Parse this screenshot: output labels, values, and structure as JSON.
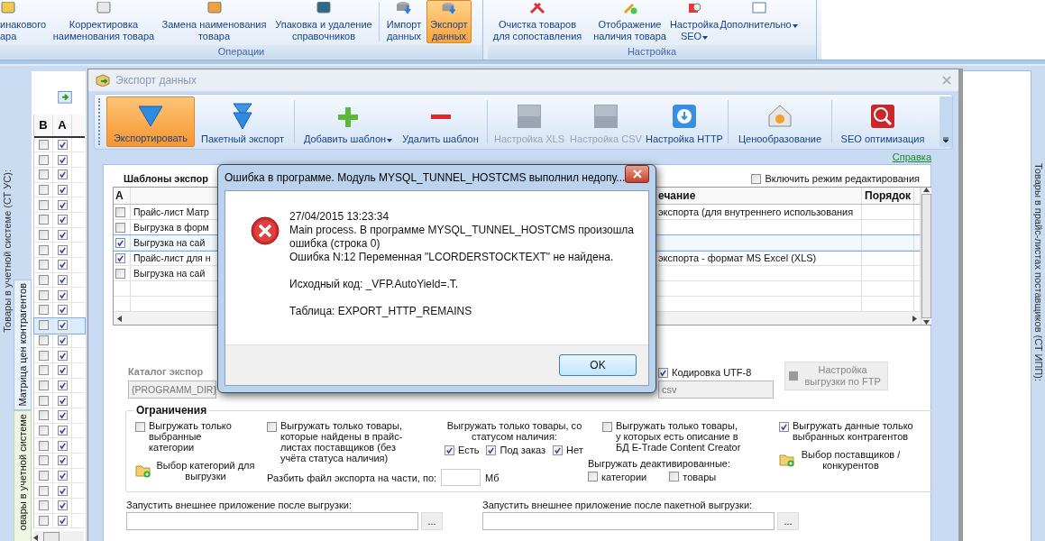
{
  "ribbon": {
    "groups": [
      {
        "label": "Операции",
        "items": [
          {
            "label": "инакового\nара",
            "selected": false,
            "dropdown": false
          },
          {
            "label": "Корректировка\nнаименования товара",
            "selected": false,
            "dropdown": false
          },
          {
            "label": "Замена наименования\nтовара",
            "selected": false,
            "dropdown": false
          },
          {
            "label": "Упаковка и удаление\nсправочников",
            "selected": false,
            "dropdown": false
          },
          {
            "label": "Импорт\nданных",
            "selected": false,
            "dropdown": false
          },
          {
            "label": "Экспорт\nданных",
            "selected": true,
            "dropdown": false
          }
        ]
      },
      {
        "label": "Настройка",
        "items": [
          {
            "label": "Очистка товаров\nдля сопоставления",
            "selected": false,
            "dropdown": false
          },
          {
            "label": "Отображение\nналичия товара",
            "selected": false,
            "dropdown": false
          },
          {
            "label": "Настройка\nSEO",
            "selected": false,
            "dropdown": true
          },
          {
            "label": "Дополнительно",
            "selected": false,
            "dropdown": true
          }
        ]
      }
    ]
  },
  "left_panel": {
    "caption": "Товары в учетной системе (СТ УС):",
    "tabs": [
      {
        "label": "Матрица цен контрагентов",
        "selected": true
      },
      {
        "label": "овары в учетной системе",
        "selected": false
      }
    ],
    "grid": {
      "columns": [
        "В",
        "А"
      ],
      "rows": [
        {
          "c1": false,
          "c2": true,
          "selected": false
        },
        {
          "c1": false,
          "c2": true,
          "selected": false
        },
        {
          "c1": false,
          "c2": true,
          "selected": false
        },
        {
          "c1": false,
          "c2": true,
          "selected": false
        },
        {
          "c1": false,
          "c2": true,
          "selected": false
        },
        {
          "c1": false,
          "c2": true,
          "selected": false
        },
        {
          "c1": false,
          "c2": true,
          "selected": false
        },
        {
          "c1": false,
          "c2": true,
          "selected": false
        },
        {
          "c1": false,
          "c2": true,
          "selected": false
        },
        {
          "c1": false,
          "c2": true,
          "selected": false
        },
        {
          "c1": false,
          "c2": true,
          "selected": false
        },
        {
          "c1": false,
          "c2": true,
          "selected": false
        },
        {
          "c1": false,
          "c2": true,
          "selected": true
        },
        {
          "c1": false,
          "c2": true,
          "selected": false
        },
        {
          "c1": false,
          "c2": true,
          "selected": false
        },
        {
          "c1": false,
          "c2": true,
          "selected": false
        },
        {
          "c1": false,
          "c2": true,
          "selected": false
        },
        {
          "c1": false,
          "c2": true,
          "selected": false
        },
        {
          "c1": false,
          "c2": true,
          "selected": false
        },
        {
          "c1": false,
          "c2": true,
          "selected": false
        },
        {
          "c1": false,
          "c2": true,
          "selected": false
        },
        {
          "c1": false,
          "c2": true,
          "selected": false
        },
        {
          "c1": false,
          "c2": true,
          "selected": false
        },
        {
          "c1": false,
          "c2": true,
          "selected": false
        },
        {
          "c1": false,
          "c2": true,
          "selected": false
        },
        {
          "c1": false,
          "c2": true,
          "selected": false
        }
      ]
    }
  },
  "right_panel": {
    "caption": "Товары в прайс-листах поставщиков (СТ ИПП):"
  },
  "export_dialog": {
    "title": "Экспорт данных",
    "toolbar": [
      {
        "label": "Экспортировать",
        "selected": true,
        "disabled": false,
        "dropdown": false
      },
      {
        "label": "Пакетный экспорт",
        "selected": false,
        "disabled": false,
        "dropdown": false
      },
      {
        "label": "Добавить шаблон",
        "selected": false,
        "disabled": false,
        "dropdown": true
      },
      {
        "label": "Удалить шаблон",
        "selected": false,
        "disabled": false,
        "dropdown": false
      },
      {
        "label": "Настройка XLS",
        "selected": false,
        "disabled": true,
        "dropdown": false
      },
      {
        "label": "Настройка CSV",
        "selected": false,
        "disabled": true,
        "dropdown": false
      },
      {
        "label": "Настройка HTTP",
        "selected": false,
        "disabled": false,
        "dropdown": false
      },
      {
        "label": "Ценообразование",
        "selected": false,
        "disabled": false,
        "dropdown": false
      },
      {
        "label": "SEO оптимизация",
        "selected": false,
        "disabled": false,
        "dropdown": false
      }
    ],
    "help_link": "Справка",
    "templates": {
      "title": "Шаблоны экспор",
      "edit_mode": {
        "label": "Включить режим редактирования",
        "checked": false
      },
      "columns": [
        "А",
        "ечание",
        "Порядок"
      ],
      "rows": [
        {
          "checked": false,
          "selected": false,
          "name": "Прайс-лист Матр",
          "note": "экспорта (для внутреннего использования"
        },
        {
          "checked": false,
          "selected": false,
          "name": "Выгрузка в форм"
        },
        {
          "checked": true,
          "selected": true,
          "name": "Выгрузка на сай"
        },
        {
          "checked": true,
          "selected": false,
          "name": "Прайс-лист для н",
          "note": "экспорта - формат MS Excel (XLS)"
        },
        {
          "checked": false,
          "selected": false,
          "name": "Выгрузка на сай"
        }
      ]
    },
    "catalog": {
      "label": "Каталог экспор",
      "value": "{PROGRAMM_DIR}",
      "file_value": "csv"
    },
    "utf8": {
      "label": "Кодировка UTF-8",
      "checked": true
    },
    "ftp_button": {
      "label": "Настройка выгрузки по FTP",
      "disabled": true
    },
    "limits": {
      "title": "Ограничения",
      "selected_categories": {
        "label": "Выгружать только выбранные категории",
        "checked": false
      },
      "categories_button": "Выбор категорий для выгрузки",
      "found_in_pricelists": {
        "label": "Выгружать только товары, которые найдены в прайс-листах поставщиков (без учёта статуса наличия)",
        "checked": false
      },
      "split": {
        "label": "Разбить файл экспорта на части, по:",
        "unit": "Мб"
      },
      "stock_status": {
        "label": "Выгружать только товары, со статусом наличия:",
        "options": [
          {
            "label": "Есть",
            "checked": true
          },
          {
            "label": "Под заказ",
            "checked": true
          },
          {
            "label": "Нет",
            "checked": true
          }
        ]
      },
      "etrade": {
        "label": "Выгружать только товары, у которых есть описание в БД E-Trade Content Creator",
        "checked": false
      },
      "deactivated": {
        "label": "Выгружать деактивированные:",
        "options": [
          {
            "label": "категории",
            "checked": false
          },
          {
            "label": "товары",
            "checked": false
          }
        ]
      },
      "contractors": {
        "label": "Выгружать данные только выбранных контрагентов",
        "checked": true
      },
      "suppliers_button": "Выбор поставщиков / конкурентов"
    },
    "launch": [
      {
        "label": "Запустить внешнее приложение после выгрузки:",
        "button": "..."
      },
      {
        "label": "Запустить внешнее приложение после пакетной выгрузки:",
        "button": "..."
      }
    ]
  },
  "error_dialog": {
    "title": "Ошибка в программе. Модуль MYSQL_TUNNEL_HOSTCMS выполнил недопу...",
    "paragraphs": [
      [
        "27/04/2015 13:23:34",
        "Main process. В программе MYSQL_TUNNEL_HOSTCMS произошла ошибка (строка 0)",
        "Ошибка N:12 Переменная \"LCORDERSTOCKTEXT\" не найдена."
      ],
      [
        "Исходный код: _VFP.AutoYield=.T."
      ],
      [
        "Таблица: EXPORT_HTTP_REMAINS"
      ]
    ],
    "button": "OK"
  }
}
